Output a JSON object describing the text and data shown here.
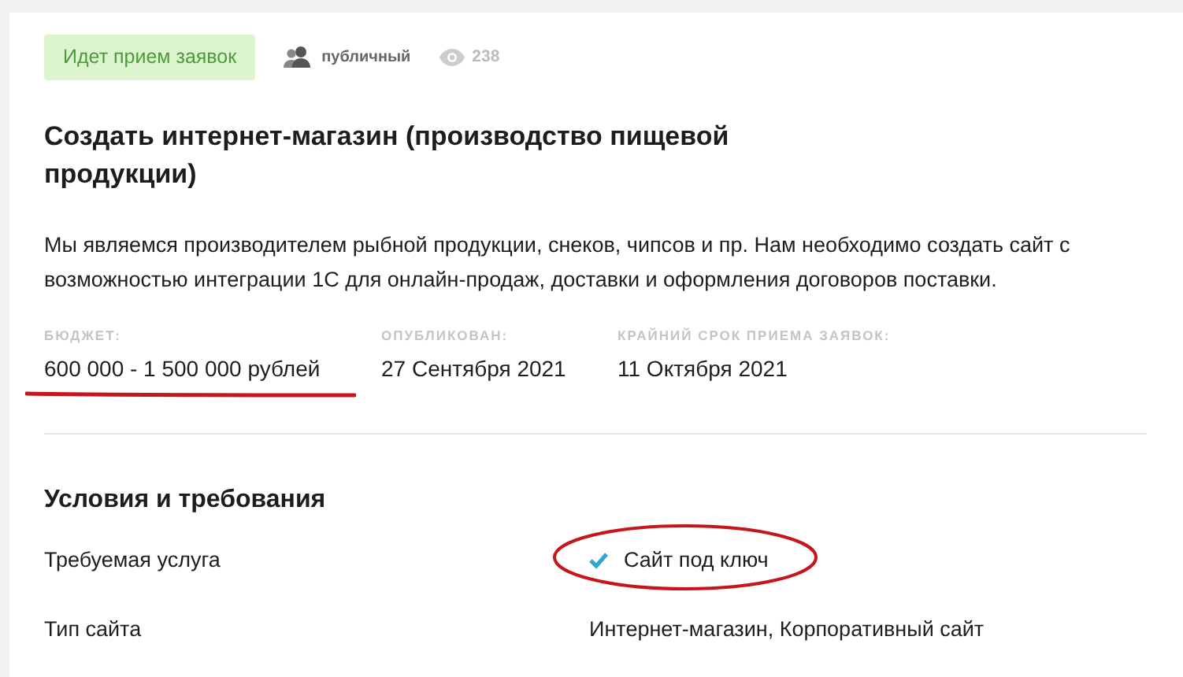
{
  "status_badge": "Идет прием заявок",
  "visibility": "публичный",
  "views": "238",
  "title": "Создать интернет-магазин (производство пищевой продукции)",
  "description": "Мы являемся производителем рыбной продукции, снеков, чипсов и пр. Нам необходимо создать сайт с возможностью интеграции 1С для онлайн-продаж, доставки и оформления договоров поставки.",
  "meta": [
    {
      "label": "БЮДЖЕТ:",
      "value": "600 000 - 1 500 000 рублей",
      "underlined": true
    },
    {
      "label": "ОПУБЛИКОВАН:",
      "value": "27 Сентября 2021",
      "underlined": false
    },
    {
      "label": "КРАЙНИЙ СРОК ПРИЕМА ЗАЯВОК:",
      "value": "11 Октября 2021",
      "underlined": false
    }
  ],
  "section_title": "Условия и требования",
  "requirements": [
    {
      "label": "Требуемая услуга",
      "value": "Сайт под ключ",
      "kind": "check",
      "circled": true
    },
    {
      "label": "Тип сайта",
      "value": "Интернет-магазин, Корпоративный сайт",
      "kind": "plain",
      "circled": false
    }
  ]
}
